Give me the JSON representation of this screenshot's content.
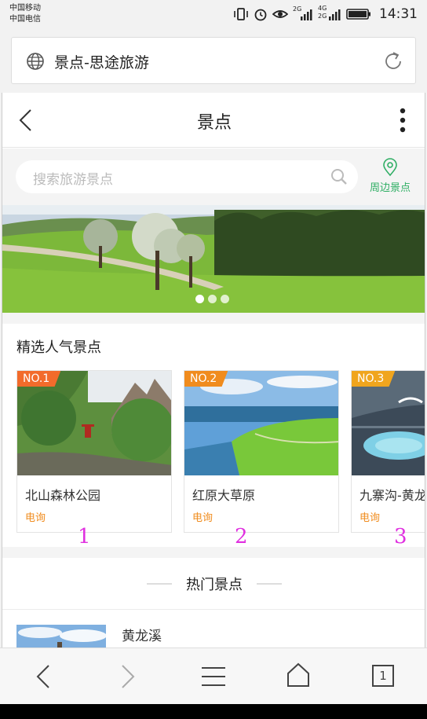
{
  "status_bar": {
    "carrier_1": "中国移动",
    "carrier_2": "中国电信",
    "network_1": "2G",
    "network_2": "4G",
    "network_3": "2G",
    "time": "14:31"
  },
  "address_bar": {
    "url_text": "景点-思途旅游"
  },
  "header": {
    "title": "景点"
  },
  "search": {
    "placeholder": "搜索旅游景点",
    "nearby_label": "周边景点"
  },
  "banner": {
    "slide_count": 3,
    "active_slide": 1
  },
  "popular": {
    "title": "精选人气景点",
    "cards": [
      {
        "rank": "NO.1",
        "name": "北山森林公园",
        "phone_label": "电询",
        "badge_color": "#f26b2b",
        "annotation": "1"
      },
      {
        "rank": "NO.2",
        "name": "红原大草原",
        "phone_label": "电询",
        "badge_color": "#f08c1e",
        "annotation": "2"
      },
      {
        "rank": "NO.3",
        "name": "九寨沟-黄龙",
        "phone_label": "电询",
        "badge_color": "#f0a51e",
        "annotation": "3"
      }
    ]
  },
  "hot": {
    "title": "热门景点",
    "items": [
      {
        "name": "黄龙溪"
      }
    ]
  },
  "browser_nav": {
    "tab_count": "1"
  },
  "colors": {
    "accent_green": "#2fae64",
    "phone_orange": "#f08c1e",
    "annotation_magenta": "#e030e0"
  }
}
